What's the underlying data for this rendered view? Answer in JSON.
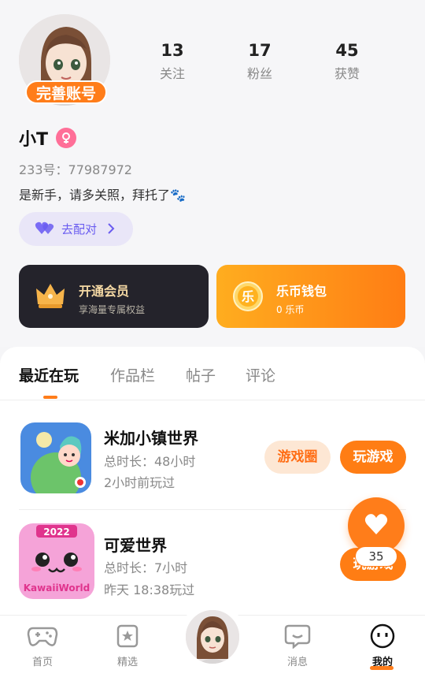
{
  "profile": {
    "complete_badge": "完善账号",
    "stats": [
      {
        "num": "13",
        "label": "关注"
      },
      {
        "num": "17",
        "label": "粉丝"
      },
      {
        "num": "45",
        "label": "获赞"
      }
    ],
    "username": "小T",
    "uid": "233号：77987972",
    "bio": "是新手，请多关照，拜托了🐾",
    "pair_button": "去配对"
  },
  "cards": {
    "vip": {
      "title": "开通会员",
      "subtitle": "享海量专属权益"
    },
    "wallet": {
      "title": "乐币钱包",
      "subtitle": "0 乐币",
      "coin_glyph": "乐"
    }
  },
  "tabs": [
    "最近在玩",
    "作品栏",
    "帖子",
    "评论"
  ],
  "games": [
    {
      "name": "米加小镇世界",
      "duration": "总时长：48小时",
      "last_played": "2小时前玩过",
      "circle_button": "游戏圈",
      "play_button": "玩游戏"
    },
    {
      "name": "可爱世界",
      "duration": "总时长：7小时",
      "last_played": "昨天 18:38玩过",
      "play_button": "玩游戏",
      "icon_text_top": "2022",
      "icon_text_bottom": "KawaiiWorld"
    }
  ],
  "like_count": "35",
  "nav": [
    {
      "label": "首页",
      "icon": "gamepad-icon"
    },
    {
      "label": "精选",
      "icon": "star-icon"
    },
    {
      "label": "消息",
      "icon": "chat-icon"
    },
    {
      "label": "我的",
      "icon": "smile-face-icon"
    }
  ],
  "colors": {
    "accent": "#ff7d1a",
    "pair_purple": "#6a5cf0",
    "vip_bg": "#24232b",
    "gender_pink": "#ff6f98"
  }
}
